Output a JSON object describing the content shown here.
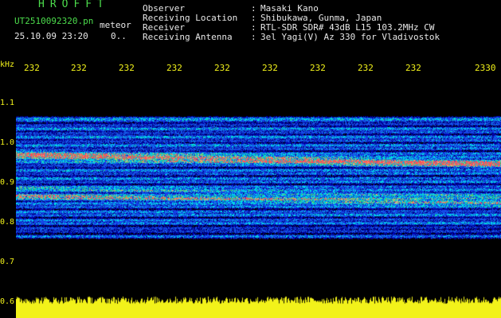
{
  "header": {
    "title": "HROFFT",
    "filename": "UT2510092320.pn",
    "type": "meteor",
    "datetime": "25.10.09 23:20",
    "count": "0..",
    "fields": [
      {
        "label": "Observer",
        "value": "Masaki Kano"
      },
      {
        "label": "Receiving Location",
        "value": "Shibukawa, Gunma, Japan"
      },
      {
        "label": "Receiver",
        "value": "RTL-SDR SDR# 43dB L15 103.2MHz CW"
      },
      {
        "label": "Receiving Antenna",
        "value": "3el Yagi(V) Az 330 for Vladivostok"
      }
    ]
  },
  "axis": {
    "unit": "kHz",
    "x_ticks": [
      "232",
      "232",
      "232",
      "232",
      "232",
      "232",
      "232",
      "232",
      "232",
      "2330"
    ],
    "y_ticks": [
      "1.1",
      "1.0",
      "0.9",
      "0.8",
      "0.7",
      "0.6"
    ]
  },
  "colors": {
    "background": "#000000",
    "header_green": "#4cdc4c",
    "label_yellow": "#f2f21a",
    "signal_red": "#ff3050",
    "noise_blue": "#1a3cff",
    "noise_cyan": "#20c0e0"
  }
}
